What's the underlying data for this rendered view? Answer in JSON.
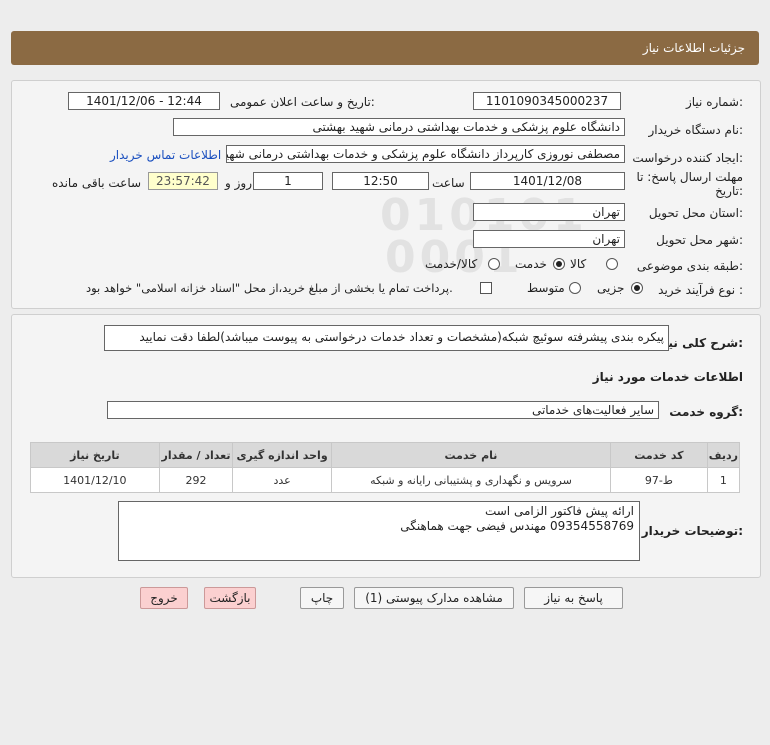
{
  "header": {
    "title": "جزئیات اطلاعات نیاز"
  },
  "form": {
    "need_number_label": "شماره نیاز:",
    "need_number": "1101090345000237",
    "announce_label": "تاریخ و ساعت اعلان عمومی:",
    "announce_value": "1401/12/06 - 12:44",
    "buyer_org_label": "نام دستگاه خریدار:",
    "buyer_org": "دانشگاه علوم پزشکی و خدمات بهداشتی درمانی شهید بهشتی",
    "creator_label": "ایجاد کننده درخواست:",
    "creator": "مصطفی نوروزی کارپرداز دانشگاه علوم پزشکی و خدمات بهداشتی درمانی شهید بهشتی",
    "contact_link": "اطلاعات تماس خریدار",
    "deadline_label_1": "مهلت ارسال پاسخ: تا",
    "deadline_label_2": "تاریخ:",
    "deadline_date": "1401/12/08",
    "time_label": "ساعت",
    "deadline_time": "12:50",
    "days_value": "1",
    "days_label": "روز و",
    "remaining_time": "23:57:42",
    "remaining_label": "ساعت باقی مانده",
    "province_label": "استان محل تحویل:",
    "province": "تهران",
    "city_label": "شهر محل تحویل:",
    "city": "تهران",
    "category_label": "طبقه بندی موضوعی:",
    "category_options": [
      "کالا",
      "خدمت",
      "کالا/خدمت"
    ],
    "category_selected": "خدمت",
    "process_label": "نوع فرآیند خرید :",
    "process_options": [
      "جزیی",
      "متوسط"
    ],
    "process_selected": "جزیی",
    "payment_note": "پرداخت تمام یا بخشی از مبلغ خرید،از محل \"اسناد خزانه اسلامی\" خواهد بود."
  },
  "details": {
    "summary_label": "شرح کلی نیاز:",
    "summary": "پیکره بندی پیشرفته سوئیچ شبکه(مشخصات و تعداد خدمات درخواستی به پیوست میباشد)لطفا دقت نمایید",
    "services_heading": "اطلاعات خدمات مورد نیاز",
    "service_group_label": "گروه خدمت:",
    "service_group": "سایر فعالیت‌های خدماتی",
    "table": {
      "headers": [
        "ردیف",
        "کد خدمت",
        "نام خدمت",
        "واحد اندازه گیری",
        "تعداد / مقدار",
        "تاریخ نیاز"
      ],
      "rows": [
        [
          "1",
          "ط-97",
          "سرویس و نگهداری و پشتیبانی رایانه و شبکه",
          "عدد",
          "292",
          "1401/12/10"
        ]
      ]
    },
    "buyer_notes_label": "توضیحات خریدار:",
    "buyer_notes_line1": "ارائه پیش فاکتور الزامی است",
    "buyer_notes_line2": "09354558769 مهندس فیضی جهت هماهنگی"
  },
  "buttons": {
    "reply": "پاسخ به نیاز",
    "attachments": "مشاهده مدارک پیوستی (1)",
    "print": "چاپ",
    "back": "بازگشت",
    "exit": "خروج"
  },
  "colors": {
    "header_bg": "#8b6a43",
    "page_bg": "#ededed",
    "exit_button_bg": "#fbd0d0"
  }
}
